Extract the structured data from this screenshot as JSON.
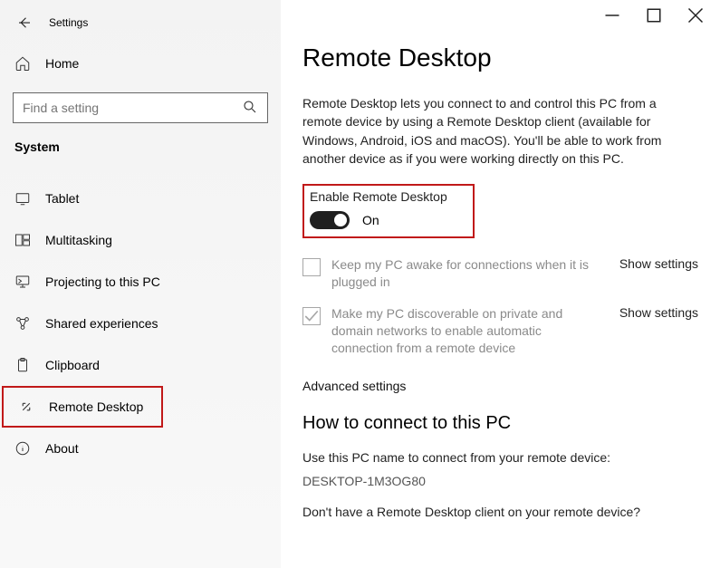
{
  "app_title": "Settings",
  "home_label": "Home",
  "search_placeholder": "Find a setting",
  "section_label": "System",
  "nav": [
    {
      "label": "Tablet"
    },
    {
      "label": "Multitasking"
    },
    {
      "label": "Projecting to this PC"
    },
    {
      "label": "Shared experiences"
    },
    {
      "label": "Clipboard"
    },
    {
      "label": "Remote Desktop"
    },
    {
      "label": "About"
    }
  ],
  "page_title": "Remote Desktop",
  "description": "Remote Desktop lets you connect to and control this PC from a remote device by using a Remote Desktop client (available for Windows, Android, iOS and macOS). You'll be able to work from another device as if you were working directly on this PC.",
  "toggle_label": "Enable Remote Desktop",
  "toggle_state": "On",
  "setting1_text": "Keep my PC awake for connections when it is plugged in",
  "setting2_text": "Make my PC discoverable on private and domain networks to enable automatic connection from a remote device",
  "show_settings": "Show settings",
  "advanced_settings": "Advanced settings",
  "connect_heading": "How to connect to this PC",
  "connect_text": "Use this PC name to connect from your remote device:",
  "pc_name": "DESKTOP-1M3OG80",
  "no_client_text": "Don't have a Remote Desktop client on your remote device?"
}
